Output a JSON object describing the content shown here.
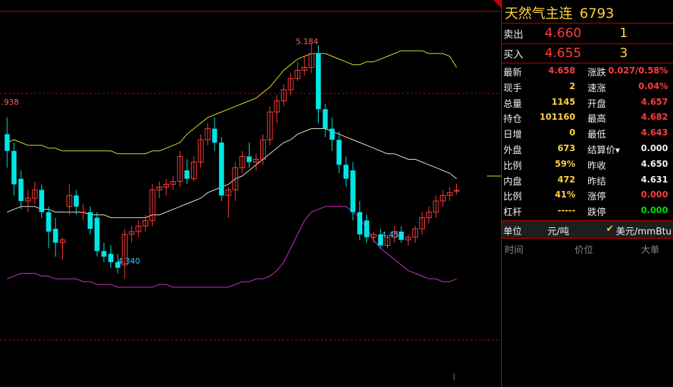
{
  "instrument": {
    "name": "天然气主连",
    "code": "6793"
  },
  "order_book": {
    "ask": {
      "label": "卖出",
      "price": "4.660",
      "volume": "1"
    },
    "bid": {
      "label": "买入",
      "price": "4.655",
      "volume": "3"
    }
  },
  "stats": [
    {
      "l1": "最新",
      "v1": "4.658",
      "c1": "red",
      "l2": "涨跌",
      "v2": "0.027/0.58%",
      "c2": "red"
    },
    {
      "l1": "现手",
      "v1": "2",
      "c1": "yellow",
      "l2": "速涨",
      "v2": "0.04%",
      "c2": "red"
    },
    {
      "l1": "总量",
      "v1": "1145",
      "c1": "yellow",
      "l2": "开盘",
      "v2": "4.657",
      "c2": "red"
    },
    {
      "l1": "持仓",
      "v1": "101160",
      "c1": "yellow",
      "l2": "最高",
      "v2": "4.682",
      "c2": "red"
    },
    {
      "l1": "日增",
      "v1": "0",
      "c1": "yellow",
      "l2": "最低",
      "v2": "4.643",
      "c2": "red"
    },
    {
      "l1": "外盘",
      "v1": "673",
      "c1": "yellow",
      "l2": "结算价▾",
      "v2": "0.000",
      "c2": "white"
    },
    {
      "l1": "比例",
      "v1": "59%",
      "c1": "yellow",
      "l2": "昨收",
      "v2": "4.650",
      "c2": "white"
    },
    {
      "l1": "内盘",
      "v1": "472",
      "c1": "yellow",
      "l2": "昨结",
      "v2": "4.631",
      "c2": "white"
    },
    {
      "l1": "比例",
      "v1": "41%",
      "c1": "yellow",
      "l2": "涨停",
      "v2": "0.000",
      "c2": "red"
    },
    {
      "l1": "杠杆",
      "v1": "-----",
      "c1": "yellow",
      "l2": "跌停",
      "v2": "0.000",
      "c2": "green"
    }
  ],
  "units": {
    "label": "单位",
    "value": "元/吨",
    "check": "✔",
    "alt_value": "美元/mmBtu"
  },
  "ticks_header": {
    "time": "时间",
    "price": "价位",
    "big": "大单"
  },
  "chart_data": {
    "type": "candlestick",
    "annotations": [
      {
        "text": "5.184",
        "value": 5.184,
        "kind": "high"
      },
      {
        "text": "4.340",
        "value": 4.34,
        "kind": "low"
      },
      {
        "text": "4.450",
        "value": 4.45,
        "kind": "low"
      },
      {
        "text": ".938",
        "value": 4.938,
        "kind": "reference"
      }
    ],
    "colors": {
      "up": "#ff3c3c",
      "down": "#00e6e6",
      "upper_band": "#e0e030",
      "mid_band": "#e8e8c8",
      "lower_band": "#d030d0",
      "grid": "#c00000"
    },
    "candles": [
      {
        "o": 4.86,
        "h": 4.92,
        "l": 4.74,
        "c": 4.8
      },
      {
        "o": 4.8,
        "h": 4.83,
        "l": 4.64,
        "c": 4.68
      },
      {
        "o": 4.7,
        "h": 4.73,
        "l": 4.59,
        "c": 4.62
      },
      {
        "o": 4.62,
        "h": 4.66,
        "l": 4.58,
        "c": 4.63
      },
      {
        "o": 4.63,
        "h": 4.69,
        "l": 4.61,
        "c": 4.66
      },
      {
        "o": 4.66,
        "h": 4.68,
        "l": 4.56,
        "c": 4.58
      },
      {
        "o": 4.58,
        "h": 4.6,
        "l": 4.45,
        "c": 4.51
      },
      {
        "o": 4.52,
        "h": 4.56,
        "l": 4.42,
        "c": 4.47
      },
      {
        "o": 4.47,
        "h": 4.49,
        "l": 4.41,
        "c": 4.48
      },
      {
        "o": 4.6,
        "h": 4.68,
        "l": 4.57,
        "c": 4.64
      },
      {
        "o": 4.64,
        "h": 4.66,
        "l": 4.57,
        "c": 4.6
      },
      {
        "o": 4.58,
        "h": 4.61,
        "l": 4.55,
        "c": 4.58
      },
      {
        "o": 4.58,
        "h": 4.6,
        "l": 4.5,
        "c": 4.52
      },
      {
        "o": 4.56,
        "h": 4.58,
        "l": 4.42,
        "c": 4.44
      },
      {
        "o": 4.44,
        "h": 4.47,
        "l": 4.4,
        "c": 4.42
      },
      {
        "o": 4.43,
        "h": 4.46,
        "l": 4.38,
        "c": 4.4
      },
      {
        "o": 4.4,
        "h": 4.43,
        "l": 4.36,
        "c": 4.38
      },
      {
        "o": 4.39,
        "h": 4.52,
        "l": 4.34,
        "c": 4.5
      },
      {
        "o": 4.5,
        "h": 4.53,
        "l": 4.47,
        "c": 4.51
      },
      {
        "o": 4.51,
        "h": 4.55,
        "l": 4.49,
        "c": 4.53
      },
      {
        "o": 4.53,
        "h": 4.57,
        "l": 4.51,
        "c": 4.55
      },
      {
        "o": 4.55,
        "h": 4.68,
        "l": 4.53,
        "c": 4.66
      },
      {
        "o": 4.66,
        "h": 4.69,
        "l": 4.63,
        "c": 4.67
      },
      {
        "o": 4.67,
        "h": 4.7,
        "l": 4.64,
        "c": 4.68
      },
      {
        "o": 4.68,
        "h": 4.71,
        "l": 4.66,
        "c": 4.69
      },
      {
        "o": 4.69,
        "h": 4.8,
        "l": 4.67,
        "c": 4.78
      },
      {
        "o": 4.73,
        "h": 4.77,
        "l": 4.68,
        "c": 4.7
      },
      {
        "o": 4.7,
        "h": 4.78,
        "l": 4.69,
        "c": 4.76
      },
      {
        "o": 4.76,
        "h": 4.86,
        "l": 4.74,
        "c": 4.84
      },
      {
        "o": 4.84,
        "h": 4.9,
        "l": 4.82,
        "c": 4.88
      },
      {
        "o": 4.88,
        "h": 4.92,
        "l": 4.8,
        "c": 4.83
      },
      {
        "o": 4.83,
        "h": 4.85,
        "l": 4.62,
        "c": 4.64
      },
      {
        "o": 4.64,
        "h": 4.67,
        "l": 4.56,
        "c": 4.66
      },
      {
        "o": 4.66,
        "h": 4.76,
        "l": 4.62,
        "c": 4.74
      },
      {
        "o": 4.74,
        "h": 4.8,
        "l": 4.72,
        "c": 4.78
      },
      {
        "o": 4.78,
        "h": 4.83,
        "l": 4.74,
        "c": 4.76
      },
      {
        "o": 4.76,
        "h": 4.79,
        "l": 4.73,
        "c": 4.77
      },
      {
        "o": 4.77,
        "h": 4.86,
        "l": 4.75,
        "c": 4.84
      },
      {
        "o": 4.84,
        "h": 4.96,
        "l": 4.82,
        "c": 4.94
      },
      {
        "o": 4.94,
        "h": 5.0,
        "l": 4.9,
        "c": 4.98
      },
      {
        "o": 4.98,
        "h": 5.04,
        "l": 4.96,
        "c": 5.02
      },
      {
        "o": 5.02,
        "h": 5.08,
        "l": 5.0,
        "c": 5.06
      },
      {
        "o": 5.06,
        "h": 5.12,
        "l": 5.05,
        "c": 5.09
      },
      {
        "o": 5.09,
        "h": 5.14,
        "l": 5.07,
        "c": 5.1
      },
      {
        "o": 5.1,
        "h": 5.184,
        "l": 5.08,
        "c": 5.15
      },
      {
        "o": 5.15,
        "h": 5.18,
        "l": 4.9,
        "c": 4.95
      },
      {
        "o": 4.95,
        "h": 4.97,
        "l": 4.85,
        "c": 4.88
      },
      {
        "o": 4.88,
        "h": 4.92,
        "l": 4.8,
        "c": 4.84
      },
      {
        "o": 4.84,
        "h": 4.87,
        "l": 4.72,
        "c": 4.75
      },
      {
        "o": 4.75,
        "h": 4.78,
        "l": 4.67,
        "c": 4.7
      },
      {
        "o": 4.73,
        "h": 4.76,
        "l": 4.55,
        "c": 4.58
      },
      {
        "o": 4.58,
        "h": 4.62,
        "l": 4.48,
        "c": 4.5
      },
      {
        "o": 4.55,
        "h": 4.57,
        "l": 4.47,
        "c": 4.49
      },
      {
        "o": 4.49,
        "h": 4.51,
        "l": 4.47,
        "c": 4.5
      },
      {
        "o": 4.5,
        "h": 4.52,
        "l": 4.45,
        "c": 4.46
      },
      {
        "o": 4.46,
        "h": 4.5,
        "l": 4.45,
        "c": 4.49
      },
      {
        "o": 4.49,
        "h": 4.53,
        "l": 4.47,
        "c": 4.51
      },
      {
        "o": 4.51,
        "h": 4.53,
        "l": 4.47,
        "c": 4.48
      },
      {
        "o": 4.48,
        "h": 4.5,
        "l": 4.46,
        "c": 4.49
      },
      {
        "o": 4.49,
        "h": 4.53,
        "l": 4.47,
        "c": 4.52
      },
      {
        "o": 4.52,
        "h": 4.58,
        "l": 4.5,
        "c": 4.56
      },
      {
        "o": 4.56,
        "h": 4.6,
        "l": 4.54,
        "c": 4.58
      },
      {
        "o": 4.58,
        "h": 4.64,
        "l": 4.56,
        "c": 4.62
      },
      {
        "o": 4.62,
        "h": 4.66,
        "l": 4.6,
        "c": 4.64
      },
      {
        "o": 4.64,
        "h": 4.67,
        "l": 4.62,
        "c": 4.65
      },
      {
        "o": 4.657,
        "h": 4.682,
        "l": 4.643,
        "c": 4.658
      }
    ],
    "upper_band": [
      4.83,
      4.84,
      4.83,
      4.82,
      4.82,
      4.82,
      4.81,
      4.81,
      4.8,
      4.8,
      4.8,
      4.8,
      4.8,
      4.8,
      4.8,
      4.8,
      4.79,
      4.79,
      4.79,
      4.79,
      4.79,
      4.8,
      4.8,
      4.81,
      4.82,
      4.83,
      4.86,
      4.88,
      4.9,
      4.92,
      4.93,
      4.94,
      4.95,
      4.96,
      4.97,
      4.98,
      4.99,
      5.01,
      5.03,
      5.06,
      5.09,
      5.11,
      5.13,
      5.14,
      5.15,
      5.15,
      5.15,
      5.14,
      5.13,
      5.12,
      5.11,
      5.11,
      5.12,
      5.12,
      5.13,
      5.14,
      5.15,
      5.16,
      5.16,
      5.16,
      5.16,
      5.15,
      5.15,
      5.15,
      5.14,
      5.1
    ],
    "mid_band": [
      4.58,
      4.59,
      4.6,
      4.6,
      4.6,
      4.59,
      4.59,
      4.58,
      4.58,
      4.58,
      4.58,
      4.58,
      4.57,
      4.57,
      4.57,
      4.56,
      4.56,
      4.56,
      4.56,
      4.56,
      4.56,
      4.57,
      4.57,
      4.58,
      4.59,
      4.6,
      4.61,
      4.62,
      4.63,
      4.65,
      4.66,
      4.67,
      4.68,
      4.7,
      4.71,
      4.73,
      4.75,
      4.77,
      4.79,
      4.81,
      4.83,
      4.84,
      4.86,
      4.87,
      4.88,
      4.88,
      4.88,
      4.87,
      4.86,
      4.85,
      4.84,
      4.83,
      4.82,
      4.81,
      4.8,
      4.79,
      4.79,
      4.78,
      4.77,
      4.77,
      4.76,
      4.75,
      4.74,
      4.73,
      4.72,
      4.7
    ],
    "lower_band": [
      4.34,
      4.35,
      4.36,
      4.36,
      4.36,
      4.35,
      4.35,
      4.34,
      4.34,
      4.34,
      4.34,
      4.33,
      4.33,
      4.32,
      4.32,
      4.32,
      4.31,
      4.31,
      4.31,
      4.31,
      4.31,
      4.31,
      4.32,
      4.32,
      4.31,
      4.31,
      4.31,
      4.31,
      4.31,
      4.31,
      4.31,
      4.31,
      4.31,
      4.32,
      4.33,
      4.33,
      4.34,
      4.34,
      4.35,
      4.37,
      4.4,
      4.45,
      4.5,
      4.55,
      4.58,
      4.59,
      4.6,
      4.6,
      4.6,
      4.6,
      4.58,
      4.56,
      4.52,
      4.48,
      4.45,
      4.43,
      4.41,
      4.39,
      4.37,
      4.36,
      4.35,
      4.34,
      4.34,
      4.33,
      4.33,
      4.34
    ]
  }
}
